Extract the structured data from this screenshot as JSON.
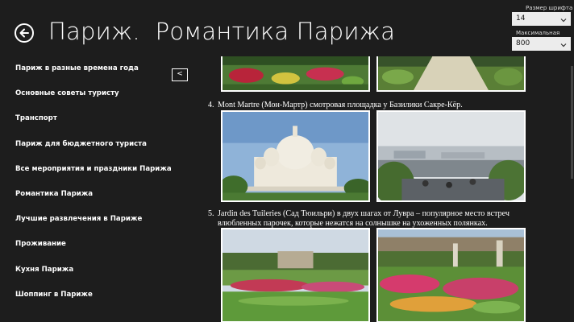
{
  "header": {
    "back_icon": "arrow-left-icon",
    "title": "Париж.  Романтика Парижа"
  },
  "settings": {
    "font_size_label": "Размер шрифта",
    "font_size_value": "14",
    "max_width_label": "Максимальная ширина",
    "max_width_value": "800"
  },
  "sidebar": {
    "items": [
      {
        "label": "Париж в разные времена года"
      },
      {
        "label": "Основные советы туристу"
      },
      {
        "label": "Транспорт"
      },
      {
        "label": "Париж для бюджетного туриста"
      },
      {
        "label": "Все мероприятия и праздники Парижа"
      },
      {
        "label": "Романтика Парижа"
      },
      {
        "label": "Лучшие развлечения в Париже"
      },
      {
        "label": "Проживание"
      },
      {
        "label": "Кухня Парижа"
      },
      {
        "label": "Шоппинг в Париже"
      }
    ],
    "collapse_label": "<"
  },
  "content": {
    "items": [
      {
        "number": "4.",
        "text": "Mont Martre (Мон-Мартр) смотровая площадка у Базилики Сакре-Кёр."
      },
      {
        "number": "5.",
        "line1": "Jardin des Tuileries (Сад Тюильри) в двух шагах от Лувра – популярное место встреч",
        "line2": "влюбленных парочек, которые нежатся на солнышке на ухоженных полянках."
      }
    ]
  }
}
